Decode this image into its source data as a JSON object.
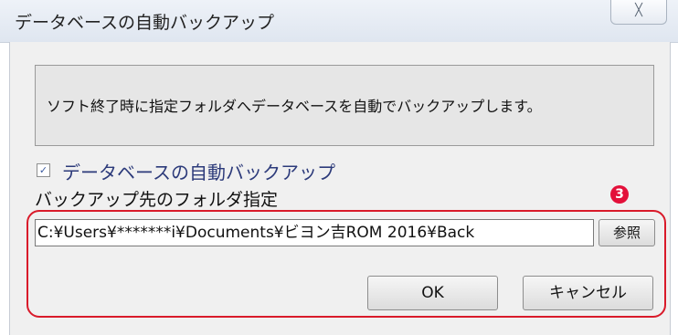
{
  "window": {
    "title": "データベースの自動バックアップ",
    "close_glyph": "╳"
  },
  "info": {
    "text": "ソフト終了時に指定フォルダへデータベースを自動でバックアップします。"
  },
  "auto_backup": {
    "label": "データベースの自動バックアップ",
    "checked": true,
    "check_glyph": "✓"
  },
  "folder": {
    "label": "バックアップ先のフォルダ指定",
    "path": "C:¥Users¥*******i¥Documents¥ビヨン吉ROM 2016¥Back",
    "browse_label": "参照"
  },
  "annotation": {
    "marker": "3",
    "color": "#d91a2a"
  },
  "buttons": {
    "ok": "OK",
    "cancel": "キャンセル"
  }
}
